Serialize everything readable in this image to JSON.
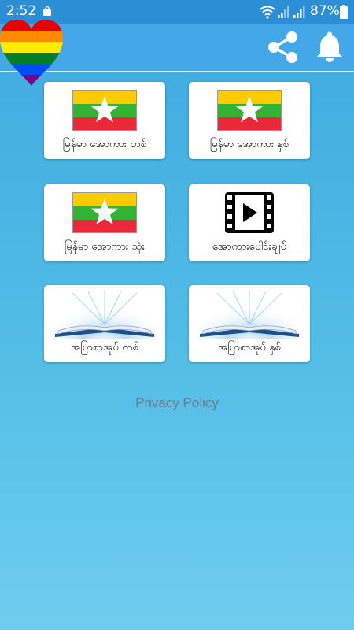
{
  "status_bar": {
    "time": "2:52",
    "battery": "87%"
  },
  "app_bar": {
    "logo_icon": "rainbow-heart",
    "share_icon": "share-icon",
    "bell_icon": "bell-icon"
  },
  "menu": {
    "items": [
      {
        "label": "မြန်မာ အောကား တစ်",
        "icon": "myanmar-flag"
      },
      {
        "label": "မြန်မာ အောကား နှစ်",
        "icon": "myanmar-flag"
      },
      {
        "label": "မြန်မာ အောကား သုံး",
        "icon": "myanmar-flag"
      },
      {
        "label": "အောကားပေါင်းချုပ်",
        "icon": "film-icon"
      },
      {
        "label": "အပြာစာအုပ် တစ်",
        "icon": "open-book"
      },
      {
        "label": "အပြာစာအုပ် နှစ်",
        "icon": "open-book"
      }
    ]
  },
  "footer": {
    "privacy_link": "Privacy Policy"
  },
  "colors": {
    "status_bar": "#2c8fd6",
    "app_bar": "#43a7e8",
    "flag_yellow": "#fecb00",
    "flag_green": "#34b233",
    "flag_red": "#ea2839"
  }
}
